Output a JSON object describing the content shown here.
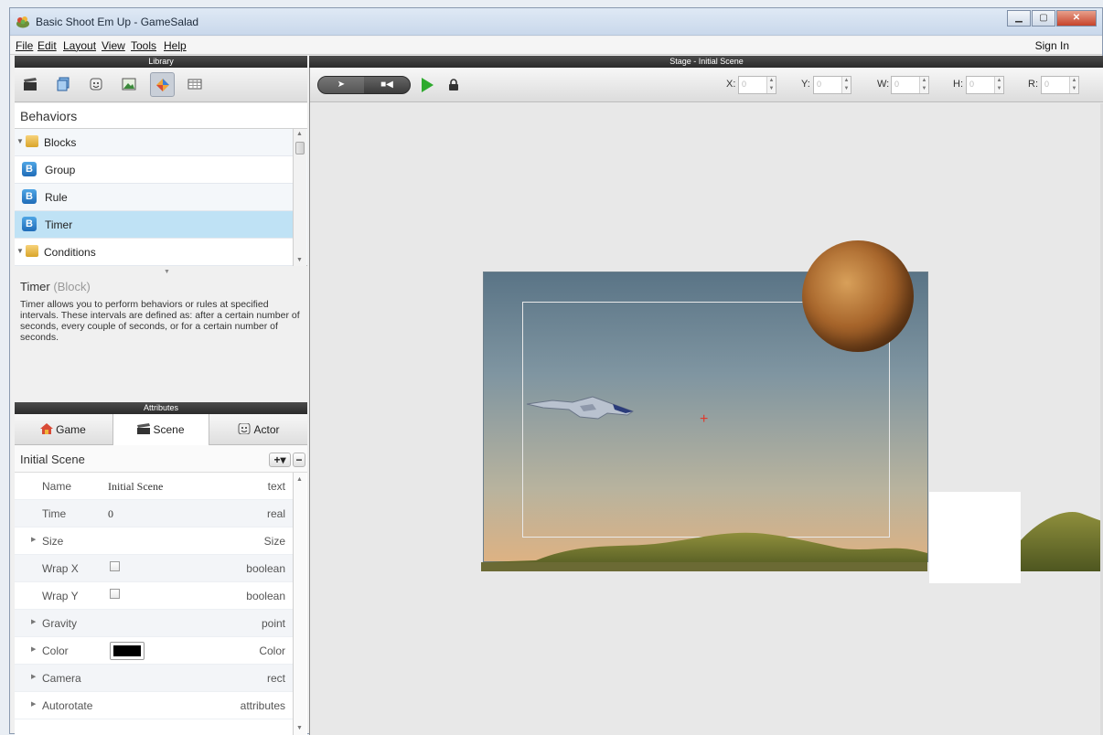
{
  "window": {
    "title": "Basic Shoot Em Up - GameSalad"
  },
  "menu": {
    "items": [
      "File",
      "Edit",
      "Layout",
      "View",
      "Tools",
      "Help"
    ],
    "sign_in": "Sign In"
  },
  "library": {
    "header": "Library",
    "tabs": [
      "scenes-clapper-icon",
      "actors-cube-icon",
      "behaviors-face-icon",
      "images-picture-icon",
      "behaviors-block-icon",
      "tables-grid-icon"
    ],
    "active_tab": 4
  },
  "behaviors": {
    "title": "Behaviors",
    "items": [
      {
        "label": "Blocks",
        "kind": "folder"
      },
      {
        "label": "Group",
        "kind": "block",
        "icon_letter": "B"
      },
      {
        "label": "Rule",
        "kind": "block",
        "icon_letter": "B"
      },
      {
        "label": "Timer",
        "kind": "block",
        "icon_letter": "B",
        "selected": true
      },
      {
        "label": "Conditions",
        "kind": "folder"
      }
    ]
  },
  "description": {
    "name": "Timer",
    "kind": "(Block)",
    "text": "Timer allows you to perform behaviors or rules at specified intervals. These intervals are defined as: after a certain number of seconds, every couple of seconds, or for a certain number of seconds."
  },
  "attributes": {
    "header": "Attributes",
    "tabs": [
      "Game",
      "Scene",
      "Actor"
    ],
    "active_tab": "Scene",
    "scene_name": "Initial Scene",
    "add_label": "+▾",
    "remove_label": "−",
    "rows": [
      {
        "name": "Name",
        "value": "Initial Scene",
        "type": "text",
        "expandable": false
      },
      {
        "name": "Time",
        "value": "0",
        "type": "real",
        "expandable": false
      },
      {
        "name": "Size",
        "value": "",
        "type": "Size",
        "expandable": true
      },
      {
        "name": "Wrap X",
        "value": "",
        "type": "boolean",
        "expandable": false,
        "checkbox": true
      },
      {
        "name": "Wrap Y",
        "value": "",
        "type": "boolean",
        "expandable": false,
        "checkbox": true
      },
      {
        "name": "Gravity",
        "value": "",
        "type": "point",
        "expandable": true
      },
      {
        "name": "Color",
        "value": "",
        "type": "Color",
        "expandable": true,
        "swatch": "#000000"
      },
      {
        "name": "Camera",
        "value": "",
        "type": "rect",
        "expandable": true
      },
      {
        "name": "Autorotate",
        "value": "",
        "type": "attributes",
        "expandable": true
      }
    ]
  },
  "stage": {
    "header": "Stage - Initial Scene",
    "fields": [
      {
        "label": "X:",
        "value": "0"
      },
      {
        "label": "Y:",
        "value": "0"
      },
      {
        "label": "W:",
        "value": "0"
      },
      {
        "label": "H:",
        "value": "0"
      },
      {
        "label": "R:",
        "value": "0"
      }
    ]
  },
  "colors": {
    "accent_selection": "#bfe2f5",
    "play_green": "#2eaa2e",
    "crosshair_red": "#e0392b"
  }
}
